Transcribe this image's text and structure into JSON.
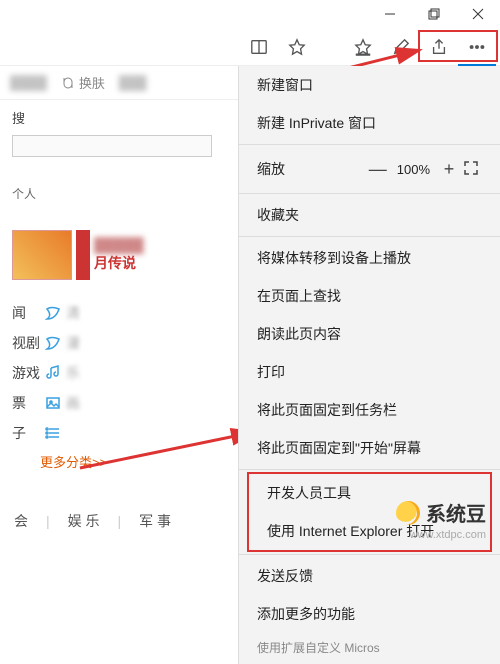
{
  "titlebar": {
    "close": "×"
  },
  "toolbar": {},
  "tabrow": {
    "swap_label": "换肤"
  },
  "left": {
    "search_label": "搜",
    "hint": "个人",
    "banner_line": "月传说",
    "cats": [
      {
        "a": "闻",
        "c": "清"
      },
      {
        "a": "视剧",
        "c": "漫"
      },
      {
        "a": "游戏",
        "c": "乐"
      },
      {
        "a": "票",
        "c": "画"
      },
      {
        "a": "子",
        "c": ""
      }
    ],
    "more": "更多分类>>"
  },
  "menu": {
    "items1": [
      "新建窗口",
      "新建 InPrivate 窗口"
    ],
    "zoom_label": "缩放",
    "zoom_pct": "100%",
    "items2": [
      "收藏夹"
    ],
    "items3": [
      "将媒体转移到设备上播放",
      "在页面上查找",
      "朗读此页内容",
      "打印",
      "将此页面固定到任务栏",
      "将此页面固定到\"开始\"屏幕"
    ],
    "items_hi": [
      "开发人员工具",
      "使用 Internet Explorer 打开"
    ],
    "items4": [
      "发送反馈",
      "添加更多的功能"
    ],
    "foot": "使用扩展自定义 Micros"
  },
  "bottom": {
    "a": "会",
    "b": "娱 乐",
    "c": "军 事"
  },
  "wm": {
    "name": "系统豆",
    "url": "www.xtdpc.com"
  }
}
